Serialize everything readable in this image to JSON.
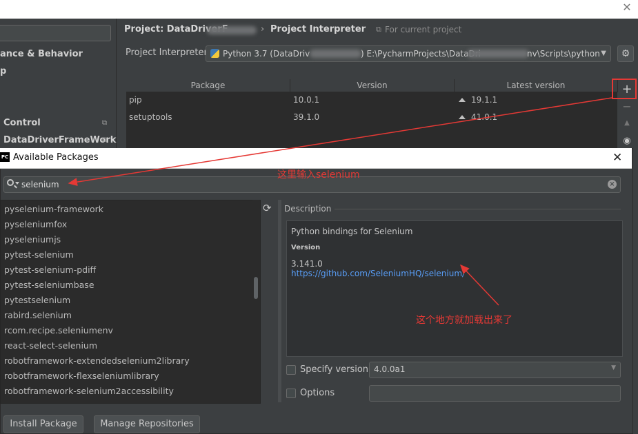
{
  "window": {
    "close_glyph": "✕"
  },
  "sidebar": {
    "items": [
      {
        "label": "ance & Behavior"
      },
      {
        "label": "p"
      },
      {
        "label": "Control"
      },
      {
        "label": "DataDriverFrameWork"
      }
    ]
  },
  "header": {
    "crumb_1": "Project: DataDriverF",
    "crumb_sep": "›",
    "crumb_2": "Project Interpreter",
    "for_current": "For current project"
  },
  "interpreter": {
    "label": "Project Interpreter:",
    "value_start": "Python 3.7 (DataDriv",
    "value_mid": ") E:\\PycharmProjects\\DataDri",
    "value_end": "nv\\Scripts\\python"
  },
  "packages_table": {
    "columns": [
      "Package",
      "Version",
      "Latest version"
    ],
    "rows": [
      {
        "package": "pip",
        "version": "10.0.1",
        "latest": "19.1.1"
      },
      {
        "package": "setuptools",
        "version": "39.1.0",
        "latest": "41.0.1"
      }
    ]
  },
  "dialog": {
    "icon_text": "PC",
    "title": "Available Packages",
    "close_glyph": "✕",
    "search_value": "selenium",
    "packages": [
      "pyselenium-framework",
      "pyseleniumfox",
      "pyseleniumjs",
      "pytest-selenium",
      "pytest-selenium-pdiff",
      "pytest-seleniumbase",
      "pytestselenium",
      "rabird.selenium",
      "rcom.recipe.seleniumenv",
      "react-select-selenium",
      "robotframework-extendedselenium2library",
      "robotframework-flexseleniumlibrary",
      "robotframework-selenium2accessibility"
    ],
    "description_label": "Description",
    "description_title": "Python bindings for Selenium",
    "version_label": "Version",
    "version_value": "3.141.0",
    "link": "https://github.com/SeleniumHQ/selenium/",
    "specify_version_label": "Specify version",
    "specify_version_value": "4.0.0a1",
    "options_label": "Options",
    "install_button": "Install Package",
    "manage_button": "Manage Repositories"
  },
  "annotations": {
    "search_hint": "这里输入selenium",
    "desc_hint": "这个地方就加载出来了"
  },
  "colors": {
    "annotation_red": "#e53935",
    "link_blue": "#589df6",
    "dark_bg": "#3c3f41"
  }
}
